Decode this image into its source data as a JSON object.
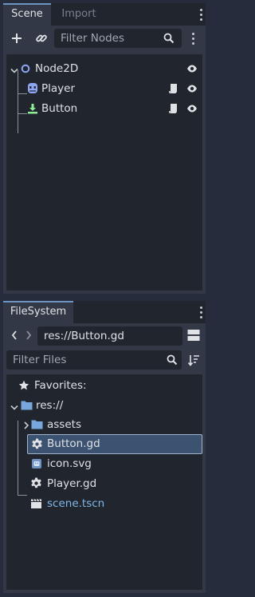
{
  "scene_dock": {
    "tabs": [
      "Scene",
      "Import"
    ],
    "filter_placeholder": "Filter Nodes",
    "nodes": [
      {
        "name": "Node2D",
        "icon": "node2d-icon"
      },
      {
        "name": "Player",
        "icon": "characterbody2d-icon"
      },
      {
        "name": "Button",
        "icon": "button-icon"
      }
    ]
  },
  "filesystem_dock": {
    "tab": "FileSystem",
    "path": "res://Button.gd",
    "filter_placeholder": "Filter Files",
    "favorites_label": "Favorites:",
    "root_label": "res://",
    "items": [
      {
        "name": "assets",
        "icon": "folder-icon"
      },
      {
        "name": "Button.gd",
        "icon": "gear-icon",
        "selected": true
      },
      {
        "name": "icon.svg",
        "icon": "image-icon"
      },
      {
        "name": "Player.gd",
        "icon": "gear-icon"
      },
      {
        "name": "scene.tscn",
        "icon": "clapperboard-icon"
      }
    ]
  },
  "colors": {
    "background": "#262c3b",
    "panel": "#323846",
    "tree": "#21262e",
    "accent": "#6f94c4",
    "selection": "#3b5270",
    "scene_file_text": "#80b6e8"
  }
}
